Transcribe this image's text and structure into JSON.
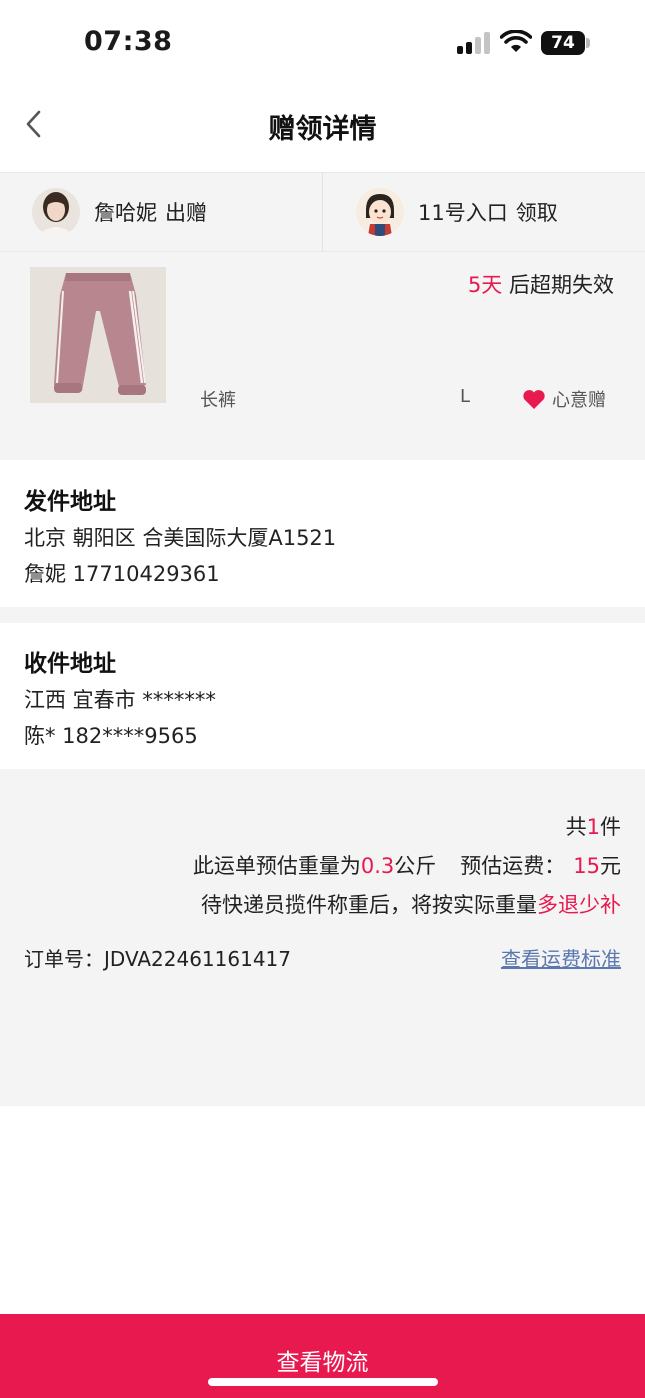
{
  "status_bar": {
    "time": "07:38",
    "battery": "74"
  },
  "nav": {
    "title": "赠领详情",
    "back_icon": "chevron-left-icon"
  },
  "giver": {
    "name": "詹哈妮",
    "action": "出赠"
  },
  "receiver": {
    "name": "11号入口",
    "action": "领取"
  },
  "item": {
    "expire_days": "5天",
    "expire_suffix": "后超期失效",
    "name": "长裤",
    "size": "L",
    "gift_tag": "心意赠",
    "gift_icon": "heart-icon",
    "colors": {
      "accent": "#e8194f"
    }
  },
  "send_address": {
    "title": "发件地址",
    "address": "北京 朝阳区 合美国际大厦A1521",
    "contact": "詹妮 17710429361"
  },
  "receive_address": {
    "title": "收件地址",
    "address": "江西 宜春市 *******",
    "contact": "陈* 182****9565"
  },
  "shipping": {
    "count_prefix": "共",
    "count": "1",
    "count_suffix": "件",
    "weight_prefix": "此运单预估重量为",
    "weight": "0.3",
    "weight_unit": "公斤",
    "fee_label": "预估运费：",
    "fee": "15",
    "fee_unit": "元",
    "note_prefix": "待快递员揽件称重后，将按实际重量",
    "note_highlight": "多退少补",
    "order_label": "订单号：",
    "order_no": "JDVA22461161417",
    "fee_standard_link": "查看运费标准"
  },
  "bottom_button": {
    "label": "查看物流"
  }
}
